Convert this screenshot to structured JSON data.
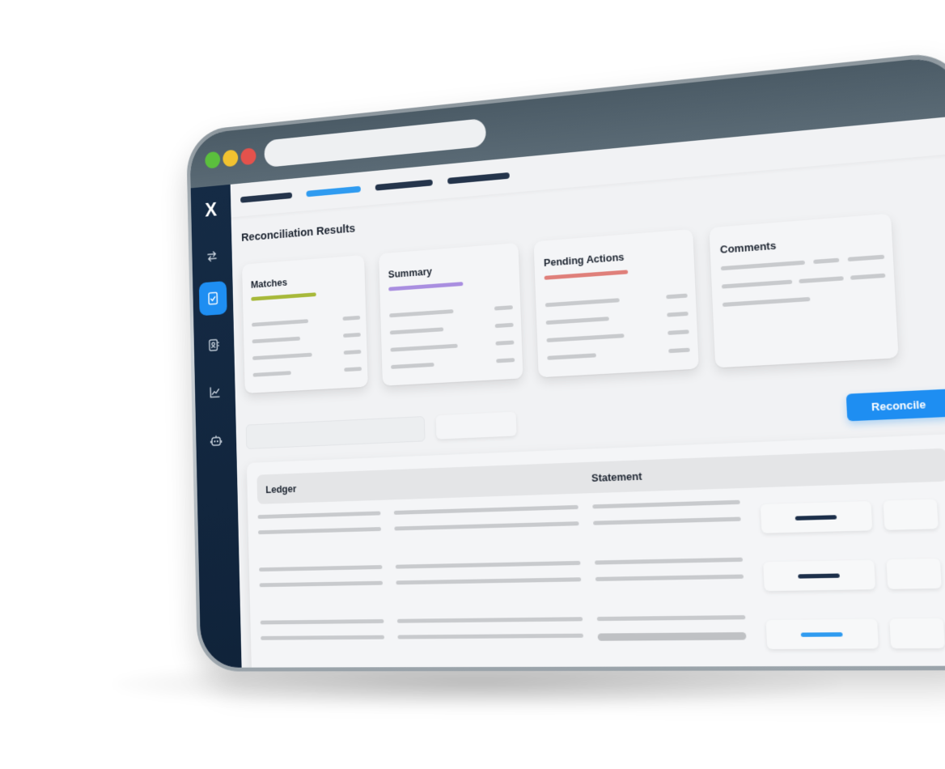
{
  "page": {
    "title": "Reconciliation Results"
  },
  "sidebar": {
    "logo": "X",
    "items": [
      {
        "icon": "transfer-arrows-icon"
      },
      {
        "icon": "document-check-icon",
        "active": true
      },
      {
        "icon": "contact-card-icon"
      },
      {
        "icon": "line-chart-icon"
      },
      {
        "icon": "robot-icon"
      }
    ]
  },
  "cards": {
    "matches": {
      "title": "Matches",
      "accent": "#a7b93a"
    },
    "summary": {
      "title": "Summary",
      "accent": "#a98ee0"
    },
    "pending": {
      "title": "Pending Actions",
      "accent": "#df7f7a"
    },
    "comments": {
      "title": "Comments"
    }
  },
  "toolbar": {
    "reconcile_label": "Reconcile"
  },
  "table": {
    "headers": {
      "ledger": "Ledger",
      "statement": "Statement"
    }
  },
  "colors": {
    "accent": "#1e8ef2",
    "sidebar": "#152b45",
    "chrome": "#4f5f6a"
  }
}
